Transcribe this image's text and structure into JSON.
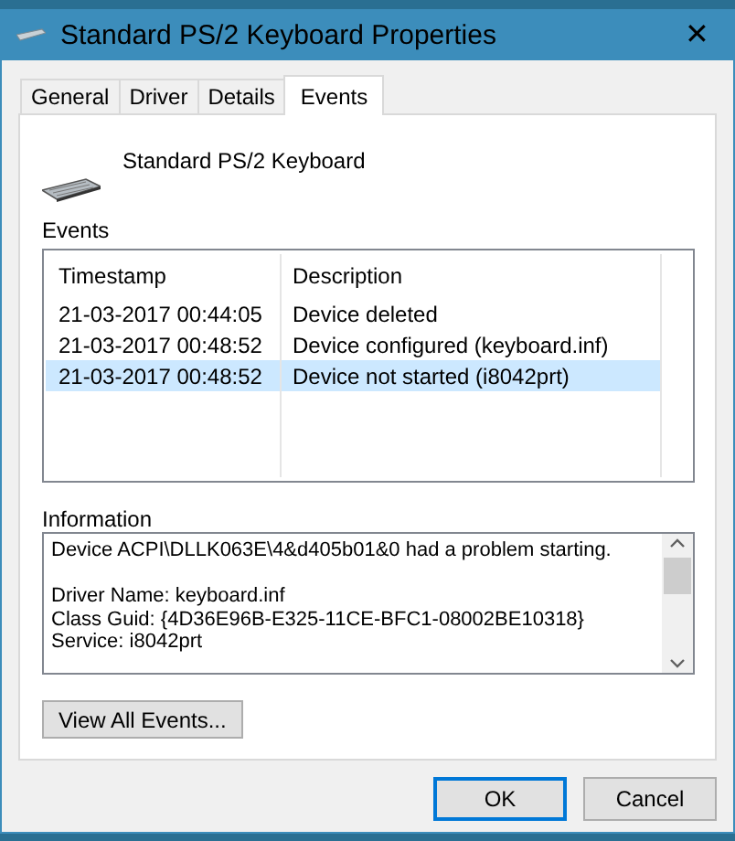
{
  "window": {
    "title": "Standard PS/2 Keyboard Properties",
    "close": "✕"
  },
  "tabs": [
    {
      "label": "General",
      "selected": false
    },
    {
      "label": "Driver",
      "selected": false
    },
    {
      "label": "Details",
      "selected": false
    },
    {
      "label": "Events",
      "selected": true
    }
  ],
  "device_name": "Standard PS/2 Keyboard",
  "events": {
    "label": "Events",
    "columns": [
      "Timestamp",
      "Description"
    ],
    "rows": [
      {
        "timestamp": "21-03-2017 00:44:05",
        "description": "Device deleted",
        "selected": false
      },
      {
        "timestamp": "21-03-2017 00:48:52",
        "description": "Device configured (keyboard.inf)",
        "selected": false
      },
      {
        "timestamp": "21-03-2017 00:48:52",
        "description": "Device not started (i8042prt)",
        "selected": true
      }
    ]
  },
  "information": {
    "label": "Information",
    "paragraphs": [
      "Device ACPI\\DLLK063E\\4&d405b01&0 had a problem starting.",
      "Driver Name: keyboard.inf\nClass Guid: {4D36E96B-E325-11CE-BFC1-08002BE10318}\nService: i8042prt"
    ]
  },
  "view_all_button": "View All Events...",
  "buttons": [
    {
      "label": "OK",
      "default": true
    },
    {
      "label": "Cancel",
      "default": false
    }
  ]
}
